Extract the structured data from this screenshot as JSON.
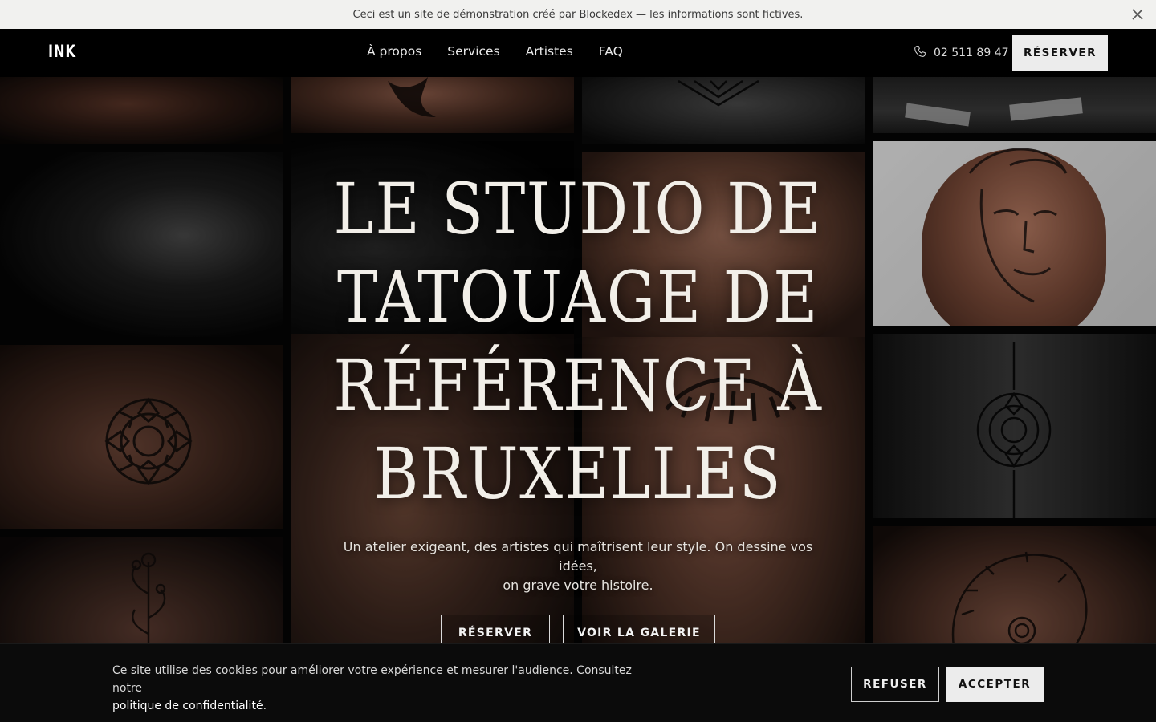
{
  "banner": {
    "text": "Ceci est un site de démonstration créé par Blockedex — les informations sont fictives."
  },
  "header": {
    "logo": "INK",
    "nav": [
      "À propos",
      "Services",
      "Artistes",
      "FAQ"
    ],
    "phone": "02 511 89 47",
    "cta": "RÉSERVER"
  },
  "hero": {
    "title_lines": [
      "LE STUDIO DE",
      "TATOUAGE DE",
      "RÉFÉRENCE À",
      "BRUXELLES"
    ],
    "subtitle_line1": "Un atelier exigeant, des artistes qui maîtrisent leur style. On dessine vos idées,",
    "subtitle_line2": "on grave votre histoire.",
    "primary_button": "RÉSERVER",
    "secondary_button": "VOIR LA GALERIE"
  },
  "cookie": {
    "text": "Ce site utilise des cookies pour améliorer votre expérience et mesurer l'audience. Consultez notre",
    "link": "politique de confidentialité",
    "link_suffix": ".",
    "refuse": "REFUSER",
    "accept": "ACCEPTER"
  }
}
